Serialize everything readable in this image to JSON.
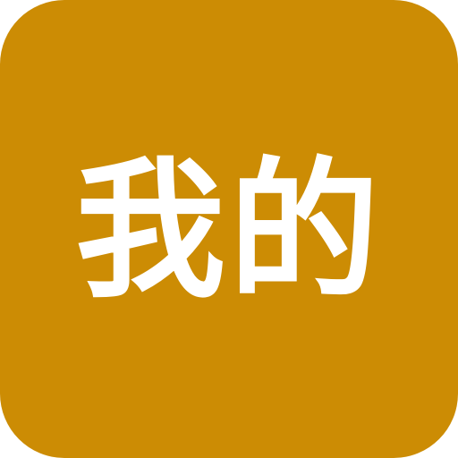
{
  "icon": {
    "label": "我的",
    "background_color": "#CC8C04",
    "text_color": "#FFFFFF"
  }
}
